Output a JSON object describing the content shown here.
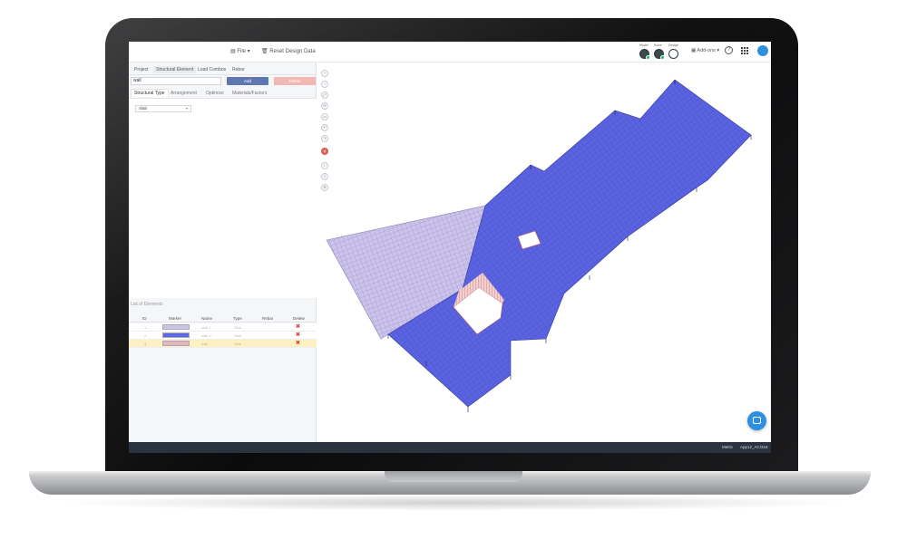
{
  "topbar": {
    "file_label": "File ▾",
    "reset_label": "Reset Design Data",
    "modes": [
      "Model",
      "Solve",
      "Design"
    ],
    "addons_label": "Add-ons ▾",
    "help_label": "?"
  },
  "tabs": [
    {
      "label": "Project"
    },
    {
      "label": "Structural Element"
    },
    {
      "label": "Load Combos"
    },
    {
      "label": "Rebar"
    }
  ],
  "element_form": {
    "name_value": "wall",
    "add_label": "Add",
    "delete_label": "Delete"
  },
  "subtabs": [
    {
      "label": "Structural Type"
    },
    {
      "label": "Arrangement"
    },
    {
      "label": "Optimize"
    },
    {
      "label": "Materials/Factors"
    }
  ],
  "structural_type_select": {
    "value": "Slab"
  },
  "element_list": {
    "title": "List of Elements",
    "columns": [
      "ID",
      "Marker",
      "Name",
      "Type",
      "Rebar",
      "Delete"
    ],
    "rows": [
      {
        "id": "1",
        "name": "slab 1",
        "type": "Slab",
        "rebar": "",
        "marker_color": "#c9c2ea",
        "selected": false
      },
      {
        "id": "2",
        "name": "slab 2",
        "type": "Slab",
        "rebar": "",
        "marker_color": "#5d6ae6",
        "selected": false
      },
      {
        "id": "3",
        "name": "wall",
        "type": "Slab",
        "rebar": "",
        "marker_color": "#e7b4c4",
        "selected": true
      }
    ]
  },
  "status": {
    "units": "Metric",
    "project": "App12_ACI318"
  },
  "colors": {
    "slab_blue": "#5a63e0",
    "slab_purple": "#c7c0e6",
    "wall_red": "#d98080",
    "accent": "#2d8fe0"
  }
}
